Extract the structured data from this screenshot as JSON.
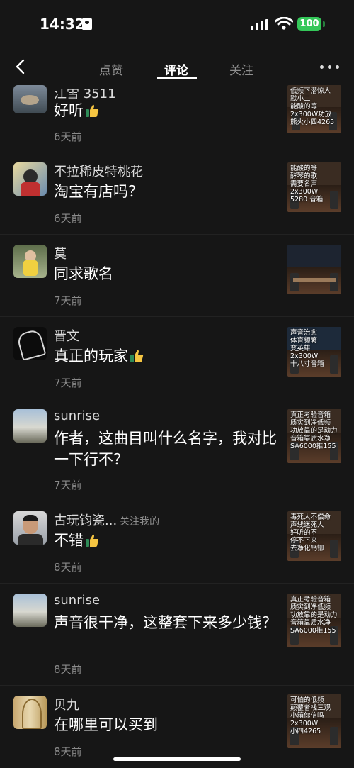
{
  "status_bar": {
    "time": "14:32",
    "battery": "100"
  },
  "nav": {
    "tabs": [
      "点赞",
      "评论",
      "关注"
    ],
    "active_tab": "评论"
  },
  "comments": [
    {
      "user": "江雪 3511",
      "text": "好听",
      "emoji": "thumbs-up",
      "date": "6天前",
      "follow": "",
      "video_caption": "低频下潜惊人\n默小二\n能酸的等\n2x300W功放\n熊火小四4265"
    },
    {
      "user": "不拉稀皮特桃花",
      "text": "淘宝有店吗？",
      "emoji": "",
      "date": "6天前",
      "follow": "",
      "video_caption": "能酸的等\n酵琴的歌\n需要名声\n2x300W\n5280 音箱"
    },
    {
      "user": "莫",
      "text": "同求歌名",
      "emoji": "",
      "date": "7天前",
      "follow": "",
      "video_caption": ""
    },
    {
      "user": "晋文",
      "text": "真正的玩家",
      "emoji": "thumbs-up",
      "date": "7天前",
      "follow": "",
      "video_caption": "声音治愈\n体育频繁\n变英雄\n2x300W\n十八寸音箱"
    },
    {
      "user": "sunrise",
      "text": "作者，这曲目叫什么名字，我对比一下行不？",
      "emoji": "",
      "date": "7天前",
      "follow": "",
      "video_caption": "真正考验音箱\n质实到净低频\n功放靠的是动力\n音箱靠质水净\nSA6000推155"
    },
    {
      "user": "古玩钧瓷...",
      "text": "不错",
      "emoji": "thumbs-up",
      "date": "8天前",
      "follow": "关注我的",
      "video_caption": "毒死人不偿命\n声线迷死人\n好听的不\n停不下来\n去净化钙铆"
    },
    {
      "user": "sunrise",
      "text": "声音很干净，这整套下来多少钱？",
      "emoji": "",
      "date": "8天前",
      "follow": "",
      "video_caption": "真正考验音箱\n质实到净低频\n功放靠的是动力\n音箱靠质水净\nSA6000推155"
    },
    {
      "user": "贝九",
      "text": "在哪里可以买到",
      "emoji": "",
      "date": "8天前",
      "follow": "",
      "video_caption": "可怕的低频\n颠覆者栈三观\n小箱你信吗\n2x300W\n小四4265"
    }
  ]
}
